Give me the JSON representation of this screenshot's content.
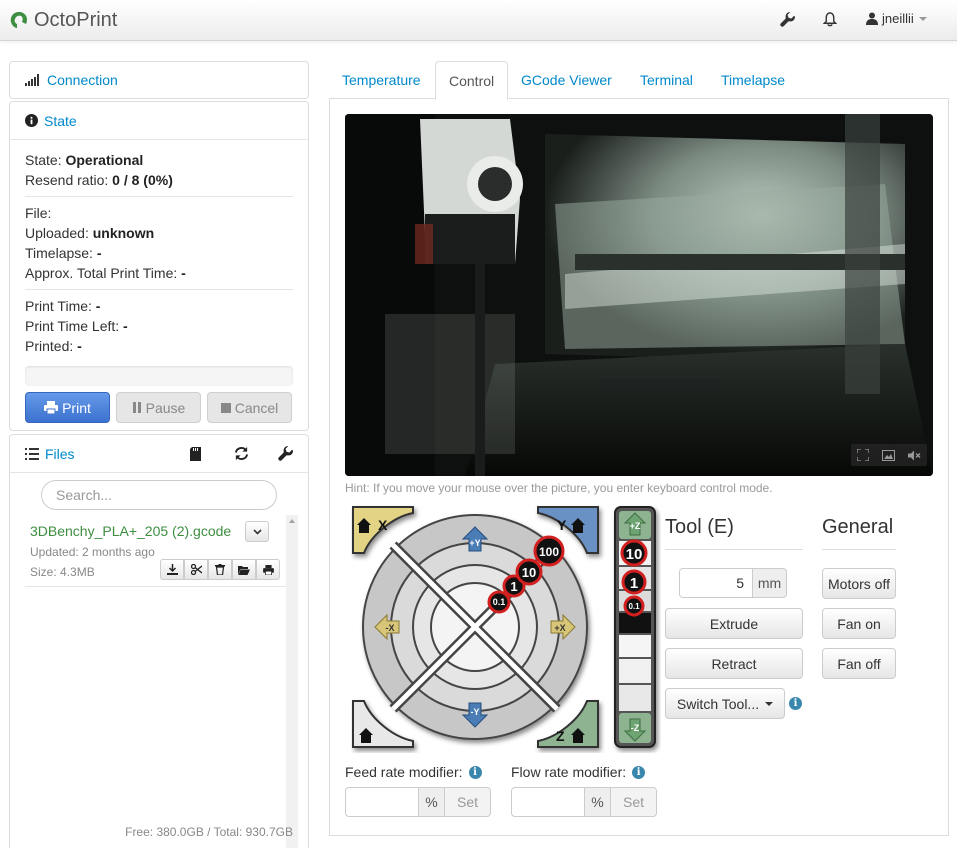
{
  "app": {
    "title": "OctoPrint",
    "brand_color": "#3e8e41"
  },
  "navbar": {
    "icons": [
      "wrench-icon",
      "bell-icon",
      "user-icon"
    ],
    "user": "jneillii"
  },
  "connection": {
    "title": "Connection"
  },
  "state": {
    "title": "State",
    "state_label": "State:",
    "state_value": "Operational",
    "resend_label": "Resend ratio:",
    "resend_value": "0 / 8 (0%)",
    "file_label": "File:",
    "uploaded_label": "Uploaded:",
    "uploaded_value": "unknown",
    "timelapse_label": "Timelapse:",
    "timelapse_value": "-",
    "approx_label": "Approx. Total Print Time:",
    "approx_value": "-",
    "print_time_label": "Print Time:",
    "print_time_value": "-",
    "time_left_label": "Print Time Left:",
    "time_left_value": "-",
    "printed_label": "Printed:",
    "printed_value": "-",
    "progress": 0,
    "buttons": {
      "print": "Print",
      "pause": "Pause",
      "cancel": "Cancel"
    }
  },
  "files": {
    "title": "Files",
    "search_placeholder": "Search...",
    "items": [
      {
        "name": "3DBenchy_PLA+_205 (2).gcode",
        "updated": "Updated: 2 months ago",
        "size": "Size: 4.3MB"
      }
    ],
    "free_space": "Free: 380.0GB / Total: 930.7GB"
  },
  "tabs": [
    "Temperature",
    "Control",
    "GCode Viewer",
    "Terminal",
    "Timelapse"
  ],
  "active_tab": "Control",
  "control": {
    "hint": "Hint: If you move your mouse over the picture, you enter keyboard control mode.",
    "jog": {
      "corner_x": "X",
      "corner_y": "Y",
      "corner_z": "Z",
      "plus_y": "+Y",
      "minus_y": "-Y",
      "plus_x": "+X",
      "minus_x": "-X",
      "plus_z": "+Z",
      "minus_z": "-Z",
      "steps": [
        "0.1",
        "1",
        "10",
        "100"
      ],
      "z_steps": [
        "10",
        "1",
        "0.1"
      ]
    },
    "tool": {
      "title": "Tool (E)",
      "amount": "5",
      "unit": "mm",
      "extrude": "Extrude",
      "retract": "Retract",
      "switch_tool": "Switch Tool..."
    },
    "general": {
      "title": "General",
      "motors_off": "Motors off",
      "fan_on": "Fan on",
      "fan_off": "Fan off"
    },
    "feed_rate": {
      "label": "Feed rate modifier:",
      "unit": "%",
      "set": "Set"
    },
    "flow_rate": {
      "label": "Flow rate modifier:",
      "unit": "%",
      "set": "Set"
    }
  }
}
